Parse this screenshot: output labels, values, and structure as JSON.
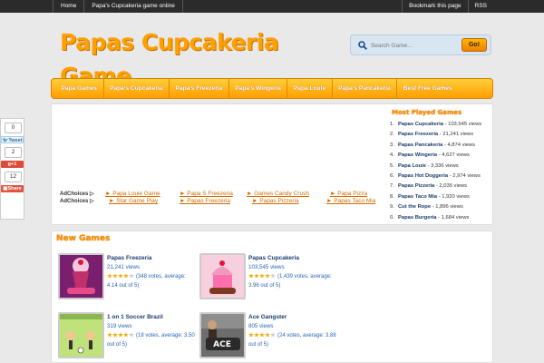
{
  "topbar": {
    "nav": [
      "Home",
      "Papa's Cupcakeria game online"
    ],
    "right": [
      "Bookmark this page",
      "RSS"
    ]
  },
  "logo": {
    "text": "Papas Cupcakeria Game",
    "color": "#ffa000"
  },
  "search": {
    "placeholder": "Search Game...",
    "go_label": "Go!"
  },
  "mainnav": [
    "Papa Games",
    "Papa's Cupcakeria",
    "Papa's Freezeria",
    "Papa's Wingeria",
    "Papa Louie",
    "Papa's Pancakeria",
    "Best Free Games"
  ],
  "social": {
    "counts": [
      "0",
      "2",
      "12"
    ],
    "tweet": "Tweet",
    "gplus": "g+1",
    "share": "Share"
  },
  "ads": {
    "adchoices": [
      "AdChoices ▷",
      "AdChoices ▷"
    ],
    "links": [
      "► Papa Louie Game",
      "► Star Game Play",
      "► Papa S Freezeria",
      "► Papas Freezeria",
      "► Games Candy Crush",
      "► Papas Pizzeria",
      "► Papa Pizza",
      "► Papas Taco Mia"
    ]
  },
  "most_played": {
    "title": "Most Played Games",
    "items": [
      {
        "num": "1.",
        "name": "Papas Cupcakeria",
        "views": " - 103,545 views"
      },
      {
        "num": "2.",
        "name": "Papas Freezeria",
        "views": " - 21,241 views"
      },
      {
        "num": "3.",
        "name": "Papas Pancakeria",
        "views": " - 4,874 views"
      },
      {
        "num": "4.",
        "name": "Papas Wingeria",
        "views": " - 4,627 views"
      },
      {
        "num": "5.",
        "name": "Papa Louie",
        "views": " - 3,336 views"
      },
      {
        "num": "6.",
        "name": "Papas Hot Doggeria",
        "views": " - 2,974 views"
      },
      {
        "num": "7.",
        "name": "Papas Pizzeria",
        "views": " - 2,035 views"
      },
      {
        "num": "8.",
        "name": "Papas Taco Mia",
        "views": " - 1,920 views"
      },
      {
        "num": "9.",
        "name": "Cut the Rope",
        "views": " - 1,896 views"
      },
      {
        "num": "0.",
        "name": "Papas Burgeria",
        "views": " - 1,684 views"
      }
    ]
  },
  "new_games": {
    "title": "New Games",
    "cards": [
      {
        "name": "Papas Freezeria",
        "views": "21,241 views",
        "rating": "(348 votes, average: 4.14 out of 5)",
        "stars": 4,
        "thumb": "papas-freezeria"
      },
      {
        "name": "Papas Cupcakeria",
        "views": "103,545 views",
        "rating": "(1,439 votes, average: 3.96 out of 5)",
        "stars": 4,
        "thumb": "papas-cupcakeria"
      },
      {
        "name": "1 on 1 Soccer Brazil",
        "views": "319 views",
        "rating": "(18 votes, average: 3.50 out of 5)",
        "stars": 4,
        "thumb": "soccer"
      },
      {
        "name": "Ace Gangster",
        "views": "805 views",
        "rating": "(24 votes, average: 3.88 out of 5)",
        "stars": 4,
        "thumb": "ace-gangster"
      }
    ]
  }
}
